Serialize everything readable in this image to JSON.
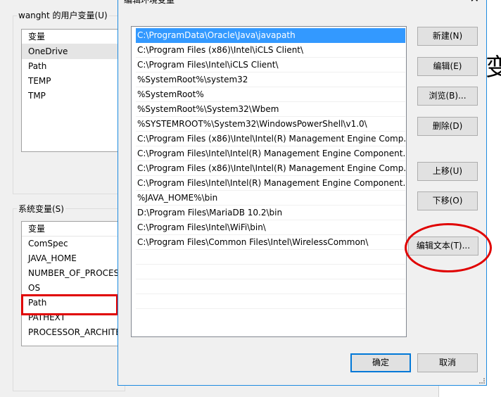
{
  "background_window": {
    "big_char": "变",
    "user_vars": {
      "group_label": "wanght 的用户变量(U)",
      "header": "变量",
      "items": [
        "OneDrive",
        "Path",
        "TEMP",
        "TMP"
      ],
      "selected": "OneDrive"
    },
    "system_vars": {
      "group_label": "系统变量(S)",
      "header": "变量",
      "items": [
        "ComSpec",
        "JAVA_HOME",
        "NUMBER_OF_PROCES",
        "OS",
        "Path",
        "PATHEXT",
        "PROCESSOR_ARCHITE"
      ],
      "highlighted": "Path"
    }
  },
  "dialog": {
    "title": "编辑环境变量",
    "close_glyph": "✕",
    "paths": [
      "C:\\ProgramData\\Oracle\\Java\\javapath",
      "C:\\Program Files (x86)\\Intel\\iCLS Client\\",
      "C:\\Program Files\\Intel\\iCLS Client\\",
      "%SystemRoot%\\system32",
      "%SystemRoot%",
      "%SystemRoot%\\System32\\Wbem",
      "%SYSTEMROOT%\\System32\\WindowsPowerShell\\v1.0\\",
      "C:\\Program Files (x86)\\Intel\\Intel(R) Management Engine Comp...",
      "C:\\Program Files\\Intel\\Intel(R) Management Engine Component...",
      "C:\\Program Files (x86)\\Intel\\Intel(R) Management Engine Comp...",
      "C:\\Program Files\\Intel\\Intel(R) Management Engine Component...",
      "%JAVA_HOME%\\bin",
      "D:\\Program Files\\MariaDB 10.2\\bin",
      "C:\\Program Files\\Intel\\WiFi\\bin\\",
      "C:\\Program Files\\Common Files\\Intel\\WirelessCommon\\"
    ],
    "selected_path": "C:\\ProgramData\\Oracle\\Java\\javapath",
    "buttons": {
      "new": "新建(N)",
      "edit": "编辑(E)",
      "browse": "浏览(B)...",
      "delete": "删除(D)",
      "move_up": "上移(U)",
      "move_down": "下移(O)",
      "edit_text": "编辑文本(T)...",
      "ok": "确定",
      "cancel": "取消"
    }
  },
  "colors": {
    "selection": "#3399ff",
    "annotation_red": "#e00000",
    "dialog_border": "#1e8be0"
  }
}
